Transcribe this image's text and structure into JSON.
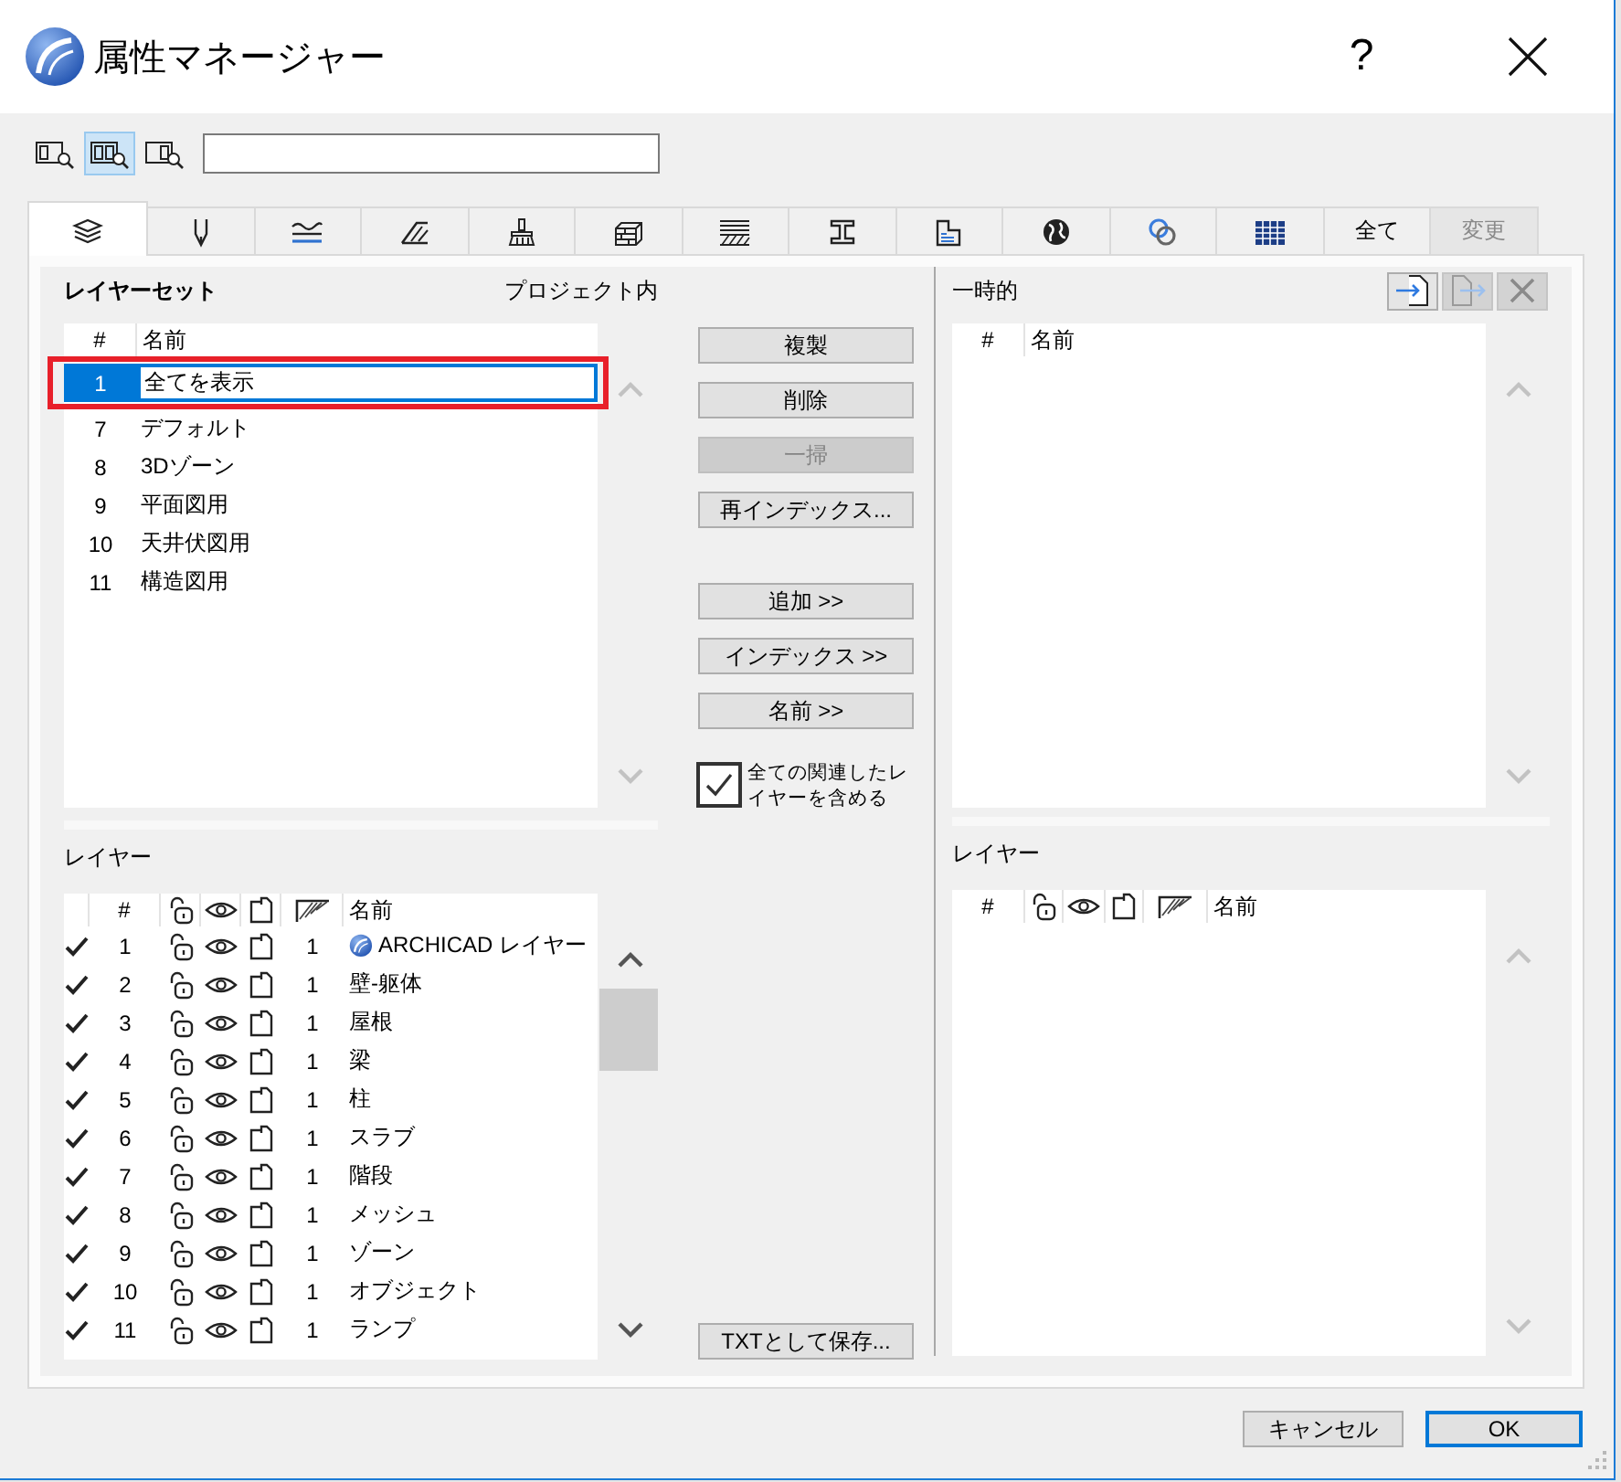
{
  "window": {
    "title": "属性マネージャー",
    "help_label": "?"
  },
  "toolbar": {
    "view_buttons": [
      {
        "kind": "left",
        "selected": false
      },
      {
        "kind": "both",
        "selected": true
      },
      {
        "kind": "right",
        "selected": false
      }
    ]
  },
  "tabs": [
    {
      "kind": "icon",
      "selected": true,
      "disabled": false
    },
    {
      "kind": "icon",
      "selected": false,
      "disabled": false
    },
    {
      "kind": "icon",
      "selected": false,
      "disabled": false
    },
    {
      "kind": "icon",
      "selected": false,
      "disabled": false
    },
    {
      "kind": "icon",
      "selected": false,
      "disabled": false
    },
    {
      "kind": "icon",
      "selected": false,
      "disabled": false
    },
    {
      "kind": "icon",
      "selected": false,
      "disabled": false
    },
    {
      "kind": "icon",
      "selected": false,
      "disabled": false
    },
    {
      "kind": "icon",
      "selected": false,
      "disabled": false
    },
    {
      "kind": "icon",
      "selected": false,
      "disabled": false
    },
    {
      "kind": "icon",
      "selected": false,
      "disabled": false
    },
    {
      "kind": "icon",
      "selected": false,
      "disabled": false
    },
    {
      "kind": "text",
      "label": "全て",
      "selected": false,
      "disabled": false
    },
    {
      "kind": "text",
      "label": "変更",
      "selected": false,
      "disabled": true
    }
  ],
  "project_panel": {
    "title": "レイヤーセット",
    "scope_label": "プロジェクト内",
    "layer_sets": {
      "number_heading": "#",
      "name_heading": "名前",
      "scrollable": false,
      "rows": [
        {
          "number": "1",
          "name": "全てを表示",
          "selected": true,
          "editing": true,
          "highlighted": true
        },
        {
          "number": "7",
          "name": "デフォルト",
          "selected": false,
          "editing": false,
          "highlighted": false
        },
        {
          "number": "8",
          "name": "3Dゾーン",
          "selected": false,
          "editing": false,
          "highlighted": false
        },
        {
          "number": "9",
          "name": "平面図用",
          "selected": false,
          "editing": false,
          "highlighted": false
        },
        {
          "number": "10",
          "name": "天井伏図用",
          "selected": false,
          "editing": false,
          "highlighted": false
        },
        {
          "number": "11",
          "name": "構造図用",
          "selected": false,
          "editing": false,
          "highlighted": false
        }
      ]
    },
    "layers_title": "レイヤー",
    "layers": {
      "number_heading": "#",
      "name_heading": "名前",
      "scrollable": true,
      "rows": [
        {
          "kind": "logo",
          "checked": true,
          "number": "1",
          "locked": false,
          "visible": true,
          "hatch_value": "1",
          "name": "ARCHICAD レイヤー"
        },
        {
          "kind": "plain",
          "checked": true,
          "number": "2",
          "locked": false,
          "visible": true,
          "hatch_value": "1",
          "name": "壁-躯体"
        },
        {
          "kind": "plain",
          "checked": true,
          "number": "3",
          "locked": false,
          "visible": true,
          "hatch_value": "1",
          "name": "屋根"
        },
        {
          "kind": "plain",
          "checked": true,
          "number": "4",
          "locked": false,
          "visible": true,
          "hatch_value": "1",
          "name": "梁"
        },
        {
          "kind": "plain",
          "checked": true,
          "number": "5",
          "locked": false,
          "visible": true,
          "hatch_value": "1",
          "name": "柱"
        },
        {
          "kind": "plain",
          "checked": true,
          "number": "6",
          "locked": false,
          "visible": true,
          "hatch_value": "1",
          "name": "スラブ"
        },
        {
          "kind": "plain",
          "checked": true,
          "number": "7",
          "locked": false,
          "visible": true,
          "hatch_value": "1",
          "name": "階段"
        },
        {
          "kind": "plain",
          "checked": true,
          "number": "8",
          "locked": false,
          "visible": true,
          "hatch_value": "1",
          "name": "メッシュ"
        },
        {
          "kind": "plain",
          "checked": true,
          "number": "9",
          "locked": false,
          "visible": true,
          "hatch_value": "1",
          "name": "ゾーン"
        },
        {
          "kind": "plain",
          "checked": true,
          "number": "10",
          "locked": false,
          "visible": true,
          "hatch_value": "1",
          "name": "オブジェクト"
        },
        {
          "kind": "plain",
          "checked": true,
          "number": "11",
          "locked": false,
          "visible": true,
          "hatch_value": "1",
          "name": "ランプ"
        }
      ]
    }
  },
  "actions": {
    "edit_buttons": [
      {
        "label": "複製",
        "disabled": false
      },
      {
        "label": "削除",
        "disabled": false
      },
      {
        "label": "一掃",
        "disabled": true
      },
      {
        "label": "再インデックス...",
        "disabled": false
      }
    ],
    "transfer_buttons": [
      {
        "label": "追加 >>",
        "disabled": false
      },
      {
        "label": "インデックス >>",
        "disabled": false
      },
      {
        "label": "名前 >>",
        "disabled": false
      }
    ],
    "include_related": {
      "label": "全ての関連したレイヤーを含める",
      "checked": true
    },
    "save_button": {
      "label": "TXTとして保存..."
    }
  },
  "temp_panel": {
    "title": "一時的",
    "buttons": [
      {
        "kind": "in",
        "disabled": false
      },
      {
        "kind": "out",
        "disabled": true
      },
      {
        "kind": "cross",
        "disabled": true
      }
    ],
    "list": {
      "number_heading": "#",
      "name_heading": "名前",
      "scrollable": false
    },
    "layers_title": "レイヤー",
    "layers": {
      "number_heading": "#",
      "name_heading": "名前",
      "scrollable": false
    }
  },
  "footer": {
    "buttons": [
      {
        "label": "キャンセル",
        "default": false
      },
      {
        "label": "OK",
        "default": true
      }
    ]
  }
}
